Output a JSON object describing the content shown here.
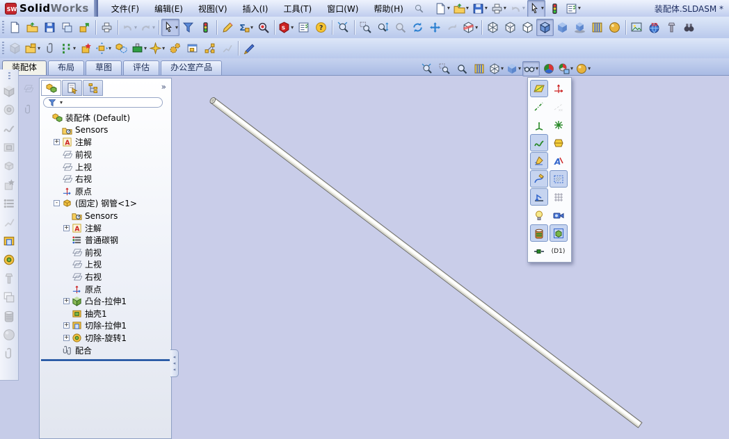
{
  "window": {
    "app_brand_bold": "Solid",
    "app_brand_light": "Works",
    "doc_title": "装配体.SLDASM *"
  },
  "glyphs": {
    "caret": "▾",
    "chevron": "»",
    "splitter_arrow": "◂",
    "expander_plus": "+",
    "expander_minus": "-"
  },
  "colors": {
    "viewport_bg": "#c9cde9",
    "rollback_bar": "#2f5fa8",
    "active_tab_bg": "#f2f2ea",
    "pressed_btn_bg": "#b9c7ea"
  },
  "menu_bar": {
    "items": [
      {
        "name": "menu-file",
        "label": "文件(F)"
      },
      {
        "name": "menu-edit",
        "label": "编辑(E)"
      },
      {
        "name": "menu-view",
        "label": "视图(V)"
      },
      {
        "name": "menu-insert",
        "label": "插入(I)"
      },
      {
        "name": "menu-tools",
        "label": "工具(T)"
      },
      {
        "name": "menu-window",
        "label": "窗口(W)"
      },
      {
        "name": "menu-help",
        "label": "帮助(H)"
      }
    ],
    "quick_items": [
      {
        "name": "qa-new-button",
        "icon": "doc",
        "dropdown": true
      },
      {
        "name": "qa-open-button",
        "icon": "folder",
        "dropdown": true
      },
      {
        "name": "qa-save-button",
        "icon": "disk",
        "dropdown": true
      },
      {
        "name": "qa-print-button",
        "icon": "printer",
        "dropdown": true
      },
      {
        "name": "qa-undo-button",
        "icon": "undo",
        "dropdown": true,
        "disabled": true
      },
      {
        "name": "qa-select-button",
        "icon": "cursor",
        "dropdown": true,
        "pressed": true
      },
      {
        "name": "qa-selection-filter-button",
        "icon": "stoplight"
      },
      {
        "name": "qa-options-button",
        "icon": "list",
        "dropdown": true
      }
    ]
  },
  "standard_toolbar": {
    "items": [
      {
        "name": "new-document-button",
        "icon": "doc"
      },
      {
        "name": "open-button",
        "icon": "folder"
      },
      {
        "name": "save-button",
        "icon": "disk"
      },
      {
        "name": "make-drawing-button",
        "icon": "window"
      },
      {
        "name": "make-assembly-button",
        "icon": "pack"
      },
      {
        "sep": true
      },
      {
        "name": "print-button",
        "icon": "printer"
      },
      {
        "sep": true
      },
      {
        "name": "undo-button",
        "icon": "undo",
        "dropdown": true,
        "disabled": true
      },
      {
        "name": "redo-button",
        "icon": "redo",
        "dropdown": true,
        "disabled": true
      },
      {
        "sep": true
      },
      {
        "name": "select-button",
        "icon": "cursor",
        "dropdown": true,
        "pressed": true
      },
      {
        "name": "filter-select-button",
        "icon": "funnel"
      },
      {
        "name": "selection-filter-toggle-button",
        "icon": "stoplight"
      },
      {
        "sep": true
      },
      {
        "name": "sketch-button",
        "icon": "pencil"
      },
      {
        "name": "measure-button",
        "icon": "sigma",
        "dropdown": true
      },
      {
        "name": "search-button",
        "icon": "search"
      },
      {
        "sep": true
      },
      {
        "name": "solidworks-resources-button",
        "icon": "swcube",
        "dropdown": true
      },
      {
        "name": "options-button",
        "icon": "list"
      },
      {
        "name": "help-button",
        "icon": "help"
      },
      {
        "sep": true
      },
      {
        "name": "zoom-to-fit-button",
        "icon": "zoomfit"
      },
      {
        "sep": true
      },
      {
        "name": "zoom-to-area-button",
        "icon": "zoomarea"
      },
      {
        "name": "zoom-in-out-button",
        "icon": "zoominout"
      },
      {
        "name": "zoom-to-selection-button",
        "icon": "zoomsel",
        "disabled": true
      },
      {
        "name": "rotate-view-button",
        "icon": "rotate"
      },
      {
        "name": "pan-button",
        "icon": "pan"
      },
      {
        "name": "previous-view-button",
        "icon": "prevview",
        "disabled": true
      },
      {
        "name": "section-view-button",
        "icon": "section",
        "dropdown": true
      },
      {
        "sep": true
      },
      {
        "name": "wireframe-button",
        "icon": "cubew"
      },
      {
        "name": "hidden-lines-visible-button",
        "icon": "cubehlv"
      },
      {
        "name": "hidden-lines-removed-button",
        "icon": "cubehlr"
      },
      {
        "name": "shaded-with-edges-button",
        "icon": "cubese",
        "pressed": true
      },
      {
        "name": "shaded-button",
        "icon": "cubes"
      },
      {
        "name": "shadows-button",
        "icon": "cubeshadow"
      },
      {
        "name": "realview-button",
        "icon": "curtain"
      },
      {
        "name": "apply-scene-button",
        "icon": "ball"
      },
      {
        "sep": true
      },
      {
        "name": "edit-appearance-button",
        "icon": "image"
      },
      {
        "name": "3d-content-central-button",
        "icon": "globe"
      },
      {
        "name": "toolbox-button",
        "icon": "bolt"
      },
      {
        "name": "design-library-button",
        "icon": "binoc"
      }
    ]
  },
  "assembly_toolbar": {
    "items": [
      {
        "name": "insert-component-button",
        "icon": "graycube",
        "disabled": true
      },
      {
        "name": "insert-components-button",
        "icon": "openpart",
        "dropdown": true
      },
      {
        "name": "mate-button",
        "icon": "clip"
      },
      {
        "name": "linear-component-pattern-button",
        "icon": "pattern",
        "dropdown": true
      },
      {
        "name": "smart-fasteners-button",
        "icon": "smart"
      },
      {
        "name": "move-component-button",
        "icon": "move",
        "dropdown": true
      },
      {
        "name": "show-hidden-components-button",
        "icon": "showhidden"
      },
      {
        "name": "assembly-features-button",
        "icon": "greenblock",
        "dropdown": true
      },
      {
        "name": "reference-geometry-button",
        "icon": "star",
        "dropdown": true
      },
      {
        "name": "motion-study-button",
        "icon": "gears"
      },
      {
        "name": "new-motion-study-button",
        "icon": "motion"
      },
      {
        "name": "exploded-view-button",
        "icon": "explode"
      },
      {
        "name": "explode-line-sketch-button",
        "icon": "explsk",
        "disabled": true
      },
      {
        "sep": true
      },
      {
        "name": "curve-sketch-button",
        "icon": "bluepencil"
      }
    ]
  },
  "command_tabs": {
    "items": [
      {
        "name": "tab-assembly",
        "label": "装配体",
        "active": true
      },
      {
        "name": "tab-layout",
        "label": "布局"
      },
      {
        "name": "tab-sketch",
        "label": "草图"
      },
      {
        "name": "tab-evaluate",
        "label": "评估"
      },
      {
        "name": "tab-office-products",
        "label": "办公室产品"
      }
    ]
  },
  "headsup_toolbar": {
    "items": [
      {
        "name": "hud-zoom-to-fit-button",
        "icon": "zoomfit"
      },
      {
        "name": "hud-zoom-to-area-button",
        "icon": "zoomarea"
      },
      {
        "name": "hud-zoom-to-selection-button",
        "icon": "zoomsel"
      },
      {
        "name": "hud-section-view-button",
        "icon": "curtain"
      },
      {
        "name": "hud-view-orientation-button",
        "icon": "cubew",
        "dropdown": true
      },
      {
        "name": "hud-display-style-button",
        "icon": "cubes",
        "dropdown": true
      },
      {
        "name": "hud-hide-show-items-button",
        "icon": "glasses",
        "dropdown": true,
        "pressed": true
      },
      {
        "name": "hud-edit-appearance-button",
        "icon": "rgball"
      },
      {
        "name": "hud-apply-scene-button",
        "icon": "scene",
        "dropdown": true
      },
      {
        "name": "hud-view-settings-button",
        "icon": "ball",
        "dropdown": true
      }
    ]
  },
  "hide_show_panel": {
    "items": [
      {
        "name": "view-planes-button",
        "icon": "plane",
        "pressed": true
      },
      {
        "name": "view-axes-button",
        "icon": "axes"
      },
      {
        "name": "view-temporary-axes-button",
        "icon": "tempaxis"
      },
      {
        "name": "view-dimension-names-button",
        "icon": "dimname",
        "disabled": true
      },
      {
        "name": "view-coordinate-systems-button",
        "icon": "csys"
      },
      {
        "name": "view-points-button",
        "icon": "aster"
      },
      {
        "name": "view-curves-button",
        "icon": "squiggle",
        "pressed": true
      },
      {
        "name": "view-origins-button",
        "icon": "hex"
      },
      {
        "name": "view-sketches-button",
        "icon": "sketch",
        "pressed": true
      },
      {
        "name": "view-annotations-button",
        "icon": "annA"
      },
      {
        "name": "view-sketch-planes-button",
        "icon": "sketchcurve",
        "pressed": true
      },
      {
        "name": "view-sketch-hatch-button",
        "icon": "hatch",
        "pressed": true
      },
      {
        "name": "view-sketch-relations-button",
        "icon": "rel",
        "pressed": true
      },
      {
        "name": "view-grid-button",
        "icon": "grid"
      },
      {
        "name": "view-lights-button",
        "icon": "bulb"
      },
      {
        "name": "view-cameras-button",
        "icon": "camera"
      },
      {
        "name": "view-decals-button",
        "icon": "jar",
        "pressed": true
      },
      {
        "name": "view-live-section-button",
        "icon": "boxcube",
        "pressed": true
      },
      {
        "name": "view-routing-points-button",
        "icon": "routing"
      },
      {
        "name": "dimension-name-label",
        "label": "(D1)",
        "text": true
      }
    ]
  },
  "features_toolbar": {
    "items": [
      {
        "name": "extruded-boss-button",
        "icon": "tboss",
        "disabled": true
      },
      {
        "name": "revolved-boss-button",
        "icon": "tcutr",
        "disabled": true
      },
      {
        "name": "swept-boss-button",
        "icon": "squiggle",
        "disabled": true
      },
      {
        "name": "lofted-boss-button",
        "icon": "tshell",
        "disabled": true
      },
      {
        "name": "fillet-button",
        "icon": "tpart",
        "disabled": true
      },
      {
        "name": "chamfer-button",
        "icon": "smart",
        "disabled": true
      },
      {
        "name": "rib-button",
        "icon": "tmat",
        "disabled": true
      },
      {
        "name": "shell-button",
        "icon": "explsk",
        "disabled": true
      },
      {
        "name": "extruded-cut-button",
        "icon": "tcute"
      },
      {
        "name": "revolved-cut-button",
        "icon": "tcutr"
      },
      {
        "name": "hole-wizard-button",
        "icon": "bolt",
        "disabled": true
      },
      {
        "name": "draft-button",
        "icon": "window",
        "disabled": true
      },
      {
        "name": "mirror-button",
        "icon": "jar",
        "disabled": true
      },
      {
        "name": "dome-button",
        "icon": "ball",
        "disabled": true
      },
      {
        "name": "wrap-button",
        "icon": "clip",
        "disabled": true
      }
    ]
  },
  "feature_tree": {
    "panel_tabs": [
      {
        "name": "featuremanager-tab",
        "icon": "tasm",
        "active": true
      },
      {
        "name": "propertymanager-tab",
        "icon": "tabprop"
      },
      {
        "name": "configurationmanager-tab",
        "icon": "tabcfg"
      }
    ],
    "items": [
      {
        "name": "tree-item-assembly-root",
        "depth": 0,
        "icon": "tasm",
        "label": "装配体 (Default)"
      },
      {
        "name": "tree-item-sensors",
        "depth": 1,
        "icon": "tsens",
        "label": "Sensors"
      },
      {
        "name": "tree-item-annotations",
        "depth": 1,
        "icon": "tann",
        "label": "注解",
        "exp": "plus"
      },
      {
        "name": "tree-item-front-plane",
        "depth": 1,
        "icon": "tplane",
        "label": "前视"
      },
      {
        "name": "tree-item-top-plane",
        "depth": 1,
        "icon": "tplane",
        "label": "上视"
      },
      {
        "name": "tree-item-right-plane",
        "depth": 1,
        "icon": "tplane",
        "label": "右视"
      },
      {
        "name": "tree-item-origin",
        "depth": 1,
        "icon": "torigin",
        "label": "原点"
      },
      {
        "name": "tree-item-steel-pipe",
        "depth": 1,
        "icon": "tpart",
        "label": "(固定) 钢管<1>",
        "exp": "minus"
      },
      {
        "name": "tree-item-pipe-sensors",
        "depth": 2,
        "icon": "tsens",
        "label": "Sensors"
      },
      {
        "name": "tree-item-pipe-annotations",
        "depth": 2,
        "icon": "tann",
        "label": "注解",
        "exp": "plus"
      },
      {
        "name": "tree-item-pipe-material",
        "depth": 2,
        "icon": "tmat",
        "label": "普通碳钢"
      },
      {
        "name": "tree-item-pipe-front-plane",
        "depth": 2,
        "icon": "tplane",
        "label": "前视"
      },
      {
        "name": "tree-item-pipe-top-plane",
        "depth": 2,
        "icon": "tplane",
        "label": "上视"
      },
      {
        "name": "tree-item-pipe-right-plane",
        "depth": 2,
        "icon": "tplane",
        "label": "右视"
      },
      {
        "name": "tree-item-pipe-origin",
        "depth": 2,
        "icon": "torigin",
        "label": "原点"
      },
      {
        "name": "tree-item-boss-extrude1",
        "depth": 2,
        "icon": "tboss",
        "label": "凸台-拉伸1",
        "exp": "plus"
      },
      {
        "name": "tree-item-shell1",
        "depth": 2,
        "icon": "tshell",
        "label": "抽壳1"
      },
      {
        "name": "tree-item-cut-extrude1",
        "depth": 2,
        "icon": "tcute",
        "label": "切除-拉伸1",
        "exp": "plus"
      },
      {
        "name": "tree-item-cut-revolve1",
        "depth": 2,
        "icon": "tcutr",
        "label": "切除-旋转1",
        "exp": "plus"
      },
      {
        "name": "tree-item-mates",
        "depth": 1,
        "icon": "tmate",
        "label": "配合"
      }
    ]
  }
}
